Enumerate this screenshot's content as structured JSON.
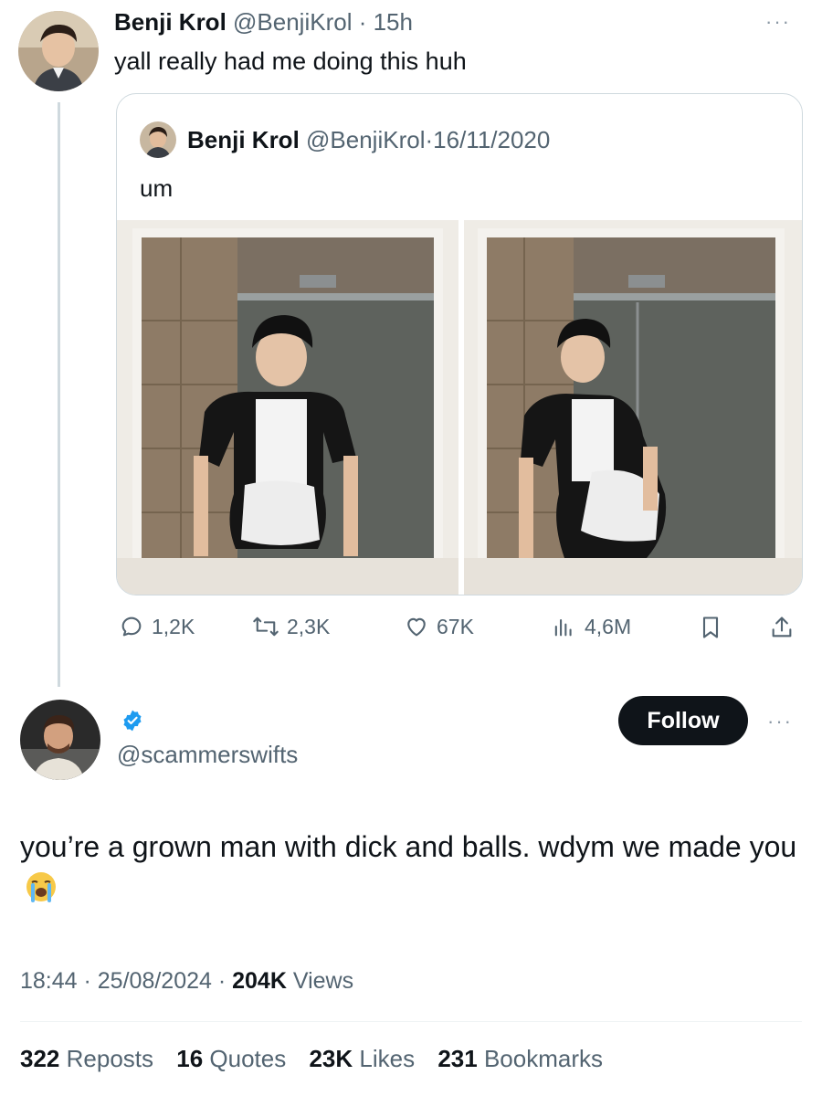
{
  "original_tweet": {
    "display_name": "Benji Krol",
    "handle": "@BenjiKrol",
    "separator": " · ",
    "time": "15h",
    "text": "yall really had me doing this huh",
    "more_label": "···"
  },
  "quoted_tweet": {
    "display_name": "Benji Krol",
    "handle": "@BenjiKrol",
    "separator": " · ",
    "date": "16/11/2020",
    "text": "um"
  },
  "actions": {
    "replies": "1,2K",
    "reposts": "2,3K",
    "likes": "67K",
    "views": "4,6M"
  },
  "reply_tweet": {
    "handle": "@scammerswifts",
    "follow_label": "Follow",
    "more_label": "···",
    "text": "you’re a grown man with dick and balls. wdym we made you",
    "emoji": "loudly-crying-face"
  },
  "reply_meta": {
    "time": "18:44",
    "date": "25/08/2024",
    "separator": " · ",
    "views_count": "204K",
    "views_label": "Views"
  },
  "reply_stats": {
    "reposts_count": "322",
    "reposts_label": "Reposts",
    "quotes_count": "16",
    "quotes_label": "Quotes",
    "likes_count": "23K",
    "likes_label": "Likes",
    "bookmarks_count": "231",
    "bookmarks_label": "Bookmarks"
  },
  "colors": {
    "text": "#0f1419",
    "muted": "#536471",
    "verified": "#1d9bf0",
    "follow_bg": "#0f1419"
  }
}
